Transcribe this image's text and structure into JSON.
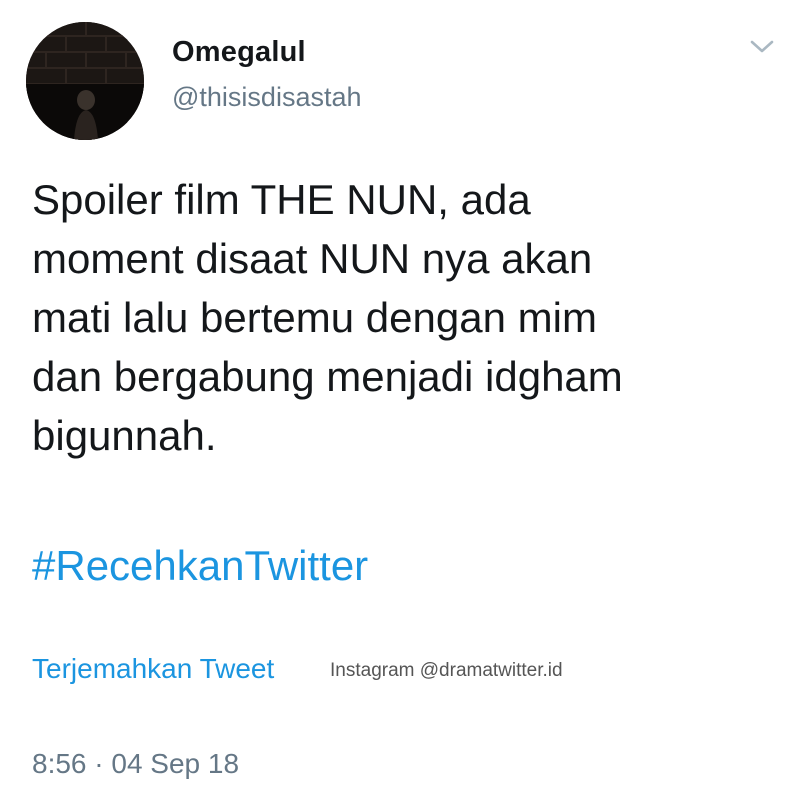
{
  "author": {
    "display_name": "Omegalul",
    "handle": "@thisisdisastah"
  },
  "tweet": {
    "text": "Spoiler film THE NUN, ada\nmoment disaat NUN nya akan\nmati lalu bertemu dengan mim\ndan bergabung menjadi idgham\nbigunnah.",
    "hashtag": "#RecehkanTwitter",
    "translate_label": "Terjemahkan Tweet",
    "timestamp": "8:56 · 04 Sep 18"
  },
  "watermark": "Instagram @dramatwitter.id",
  "icons": {
    "menu": "chevron-down-icon"
  },
  "colors": {
    "link": "#1b95e0",
    "secondary_text": "#657786",
    "primary_text": "#14171a"
  }
}
